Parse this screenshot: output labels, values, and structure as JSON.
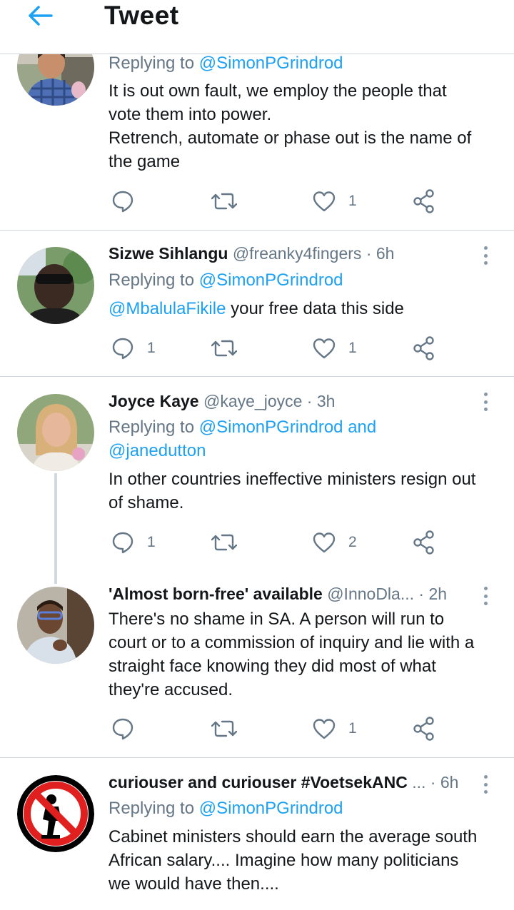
{
  "header": {
    "title": "Tweet",
    "back_icon": "arrow-left-icon",
    "accent": "#1da1f2"
  },
  "tweets": [
    {
      "replying_label": "Replying to",
      "replying_to": "@SimonPGrindrod",
      "text_lines": [
        "It is out own fault, we employ the people that",
        "vote them into power.",
        "Retrench, automate or phase out is the name of",
        "the game"
      ],
      "replies": "",
      "likes": "1"
    },
    {
      "name": "Sizwe Sihlangu",
      "handle": "@freanky4fingers",
      "time": "· 6h",
      "replying_label": "Replying to",
      "replying_to": "@SimonPGrindrod",
      "mention": "@MbalulaFikile",
      "text_rest": " your free data this side",
      "replies": "1",
      "likes": "1"
    },
    {
      "name": "Joyce Kaye",
      "handle": "@kaye_joyce",
      "time": "· 3h",
      "replying_label": "Replying to",
      "replying_to": "@SimonPGrindrod and",
      "replying_to_2": "@janedutton",
      "text_lines": [
        "In other countries ineffective ministers resign out",
        "of shame."
      ],
      "replies": "1",
      "likes": "2"
    },
    {
      "name": "'Almost born-free' available",
      "handle": "@InnoDla...",
      "time": "· 2h",
      "text_lines": [
        "There's no shame in SA. A person will run to",
        "court or to a commission of inquiry and lie with a",
        "straight face knowing they did most of what",
        "they're accused."
      ],
      "replies": "",
      "likes": "1"
    },
    {
      "name": "curiouser and curiouser #VoetsekANC",
      "handle": "...",
      "time": "· 6h",
      "replying_label": "Replying to",
      "replying_to": "@SimonPGrindrod",
      "text_lines": [
        "Cabinet ministers should earn the average south",
        "African salary.... Imagine how many politicians",
        "we would have then...."
      ]
    }
  ],
  "icons": {
    "reply": "reply-bubble-icon",
    "retweet": "retweet-icon",
    "like": "heart-icon",
    "share": "share-icon",
    "more": "more-vertical-icon"
  }
}
